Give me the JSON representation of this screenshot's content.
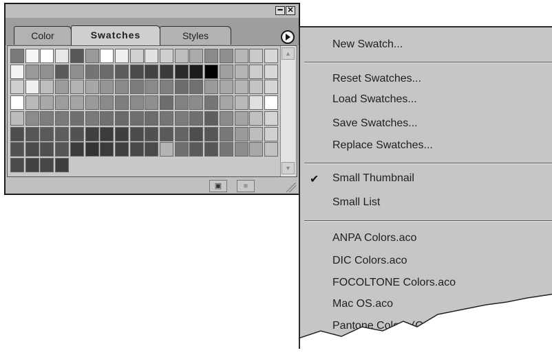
{
  "palette": {
    "tabs": [
      "Color",
      "Swatches",
      "Styles"
    ],
    "active_tab": "Swatches",
    "window_buttons": {
      "minimize": "━",
      "close": "✕"
    },
    "status_buttons": {
      "new_swatch": "▣",
      "delete": "■"
    }
  },
  "swatches": {
    "columns": 18,
    "rows": [
      [
        "#7a7a7a",
        "#f4f4f4",
        "#ffffff",
        "#e8e8e8",
        "#585858",
        "#9a9a9a",
        "#ffffff",
        "#efefef",
        "#d0d0d0",
        "#e2e2e2",
        "#cfcfcf",
        "#bdbdbd",
        "#aaaaaa",
        "#8a8a8a",
        "#8f8f8f",
        "#b8b8b8",
        "#cacaca",
        "#d8d8d8"
      ],
      [
        "#f2f2f2",
        "#9a9a9a",
        "#909090",
        "#5a5a5a",
        "#8f8f8f",
        "#747474",
        "#6a6a6a",
        "#5b5b5b",
        "#4a4a4a",
        "#434343",
        "#3a3a3a",
        "#2c2c2c",
        "#1c1c1c",
        "#000000",
        "#a0a0a0",
        "#b6b6b6",
        "#cccccc",
        "#d8d8d8"
      ],
      [
        "#cfcfcf",
        "#efefef",
        "#bdbdbd",
        "#9c9c9c",
        "#b3b3b3",
        "#a7a7a7",
        "#969696",
        "#8a8a8a",
        "#7c7c7c",
        "#8a8a8a",
        "#7f7f7f",
        "#6c6c6c",
        "#717171",
        "#9a9a9a",
        "#a9a9a9",
        "#b5b5b5",
        "#c4c4c4",
        "#d6d6d6"
      ],
      [
        "#ffffff",
        "#b9b9b9",
        "#a8a8a8",
        "#9d9d9d",
        "#a5a5a5",
        "#9a9a9a",
        "#8a8a8a",
        "#7e7e7e",
        "#8a8a8a",
        "#8f8f8f",
        "#6d6d6d",
        "#828282",
        "#8b8b8b",
        "#767676",
        "#a6a6a6",
        "#b9b9b9",
        "#e0e0e0",
        "#ffffff"
      ],
      [
        "#bcbcbc",
        "#8c8c8c",
        "#7d7d7d",
        "#7a7a7a",
        "#6f6f6f",
        "#7a7a7a",
        "#707070",
        "#6a6a6a",
        "#6e6e6e",
        "#6c6c6c",
        "#757575",
        "#7c7c7c",
        "#707070",
        "#5f5f5f",
        "#8b8b8b",
        "#a4a4a4",
        "#c0c0c0",
        "#d4d4d4"
      ],
      [
        "#4e4e4e",
        "#555555",
        "#5a5a5a",
        "#5e5e5e",
        "#525252",
        "#404040",
        "#3c3c3c",
        "#3f3f3f",
        "#4b4b4b",
        "#505050",
        "#5a5a5a",
        "#646464",
        "#4d4d4d",
        "#565656",
        "#777777",
        "#999999",
        "#bdbdbd",
        "#d0d0d0"
      ],
      [
        "#525252",
        "#4a4a4a",
        "#4f4f4f",
        "#565656",
        "#3c3c3c",
        "#333333",
        "#3b3b3b",
        "#404040",
        "#484848",
        "#4a4a4a",
        "#b4b4b4",
        "#707070",
        "#5a5a5a",
        "#565656",
        "#767676",
        "#8c8c8c",
        "#a8a8a8",
        "#c2c2c2"
      ],
      [
        "#4a4a4a",
        "#424242",
        "#474747",
        "#3e3e3e"
      ]
    ]
  },
  "menu": {
    "items_group1": [
      "New Swatch..."
    ],
    "items_group2": [
      "Reset Swatches...",
      "Load Swatches...",
      "Save Swatches...",
      "Replace Swatches..."
    ],
    "items_group3": [
      "Small Thumbnail",
      "Small List"
    ],
    "items_group4": [
      "ANPA Colors.aco",
      "DIC Colors.aco",
      "FOCOLTONE Colors.aco",
      "Mac OS.aco",
      "Pantone Colors (Coa"
    ],
    "checked_item": "Small Thumbnail",
    "check_mark": "✔"
  }
}
